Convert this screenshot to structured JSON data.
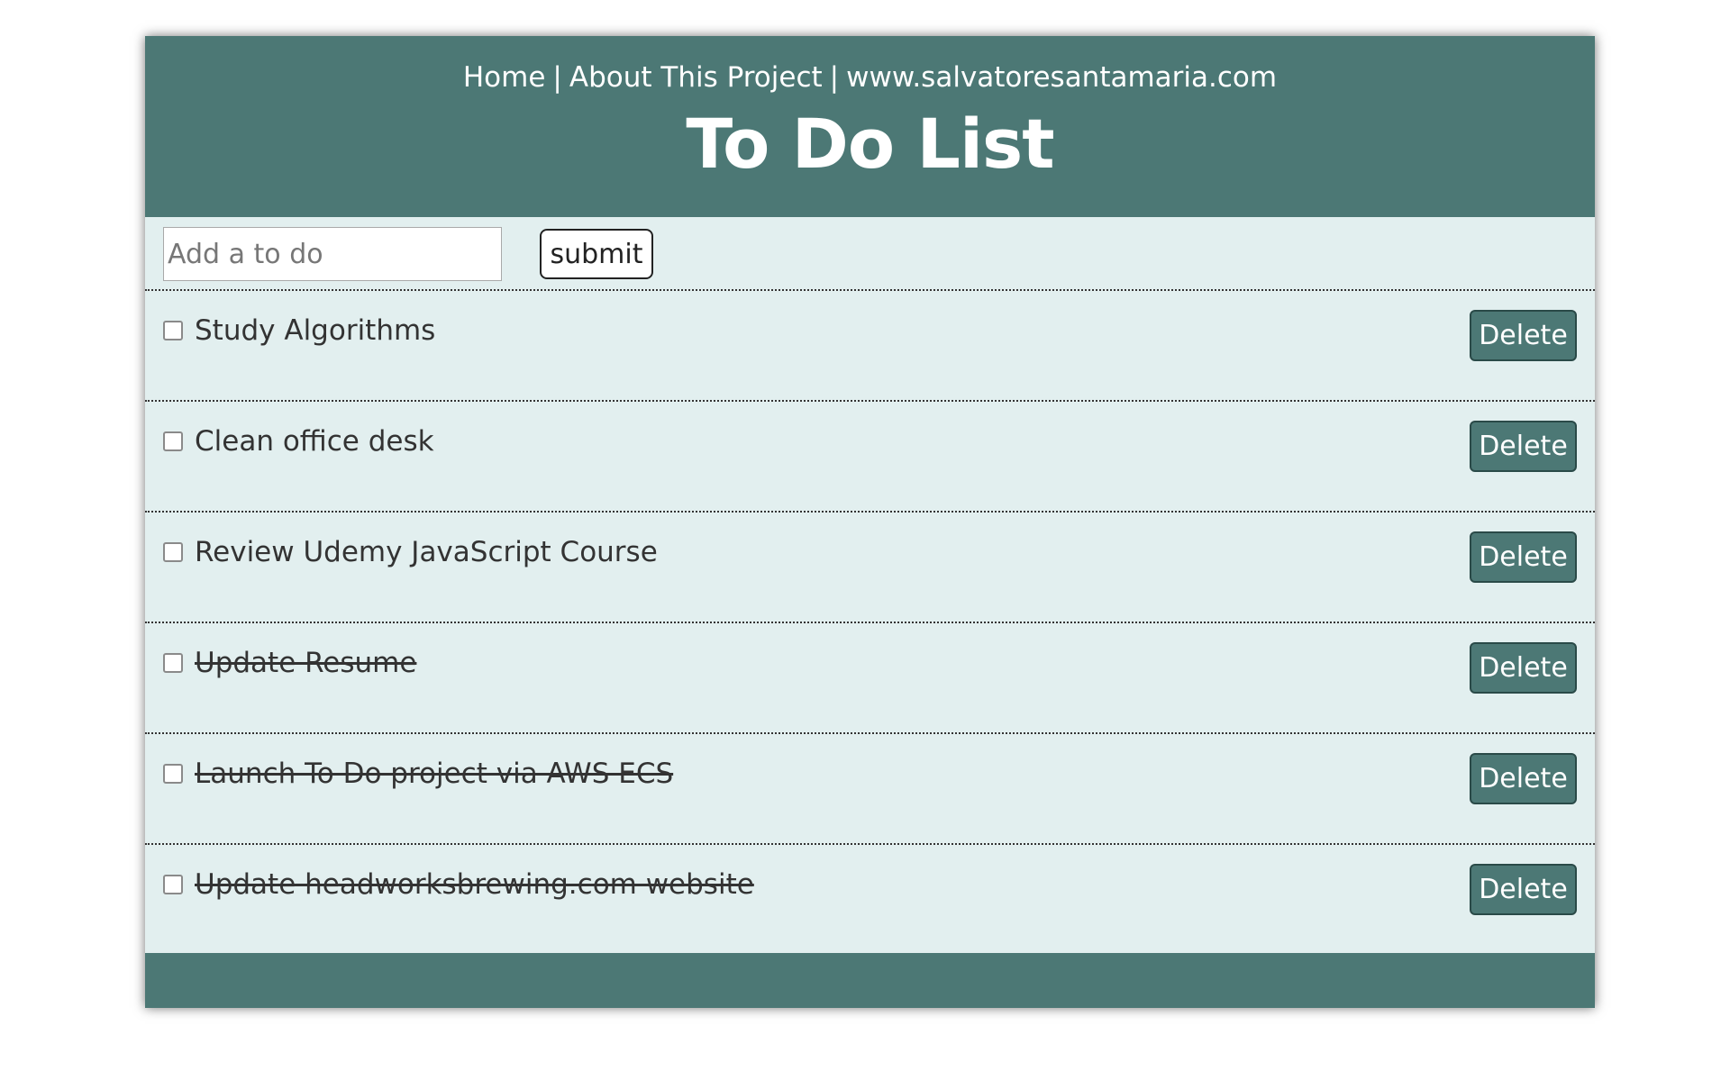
{
  "nav": {
    "home": "Home",
    "about": "About This Project",
    "site": "www.salvatoresantamaria.com",
    "separator": "|"
  },
  "title": "To Do List",
  "form": {
    "placeholder": "Add a to do",
    "value": "",
    "submit_label": "submit"
  },
  "todos": [
    {
      "text": "Study Algorithms",
      "done": false,
      "delete_label": "Delete"
    },
    {
      "text": "Clean office desk",
      "done": false,
      "delete_label": "Delete"
    },
    {
      "text": "Review Udemy JavaScript Course",
      "done": false,
      "delete_label": "Delete"
    },
    {
      "text": "Update Resume",
      "done": true,
      "delete_label": "Delete"
    },
    {
      "text": "Launch To Do project via AWS ECS",
      "done": true,
      "delete_label": "Delete"
    },
    {
      "text": "Update headworksbrewing.com website",
      "done": true,
      "delete_label": "Delete"
    }
  ],
  "colors": {
    "brand": "#4c7875",
    "panel": "#e2efef"
  }
}
